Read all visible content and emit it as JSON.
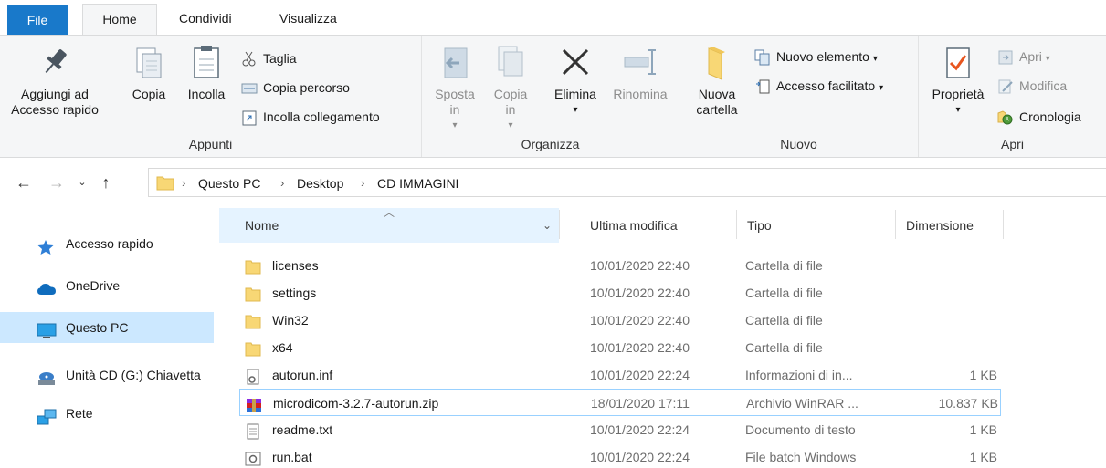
{
  "tabs": {
    "file": "File",
    "home": "Home",
    "share": "Condividi",
    "view": "Visualizza"
  },
  "ribbon": {
    "clipboard": {
      "label": "Appunti",
      "pin": "Aggiungi ad Accesso rapido",
      "copy": "Copia",
      "paste": "Incolla",
      "cut": "Taglia",
      "copy_path": "Copia percorso",
      "paste_shortcut": "Incolla collegamento"
    },
    "organize": {
      "label": "Organizza",
      "move_to": "Sposta in",
      "copy_to": "Copia in",
      "delete": "Elimina",
      "rename": "Rinomina"
    },
    "new": {
      "label": "Nuovo",
      "new_folder": "Nuova cartella",
      "new_item": "Nuovo elemento",
      "easy_access": "Accesso facilitato"
    },
    "open": {
      "label": "Apri",
      "properties": "Proprietà",
      "open": "Apri",
      "edit": "Modifica",
      "history": "Cronologia"
    }
  },
  "address": {
    "crumbs": [
      "Questo PC",
      "Desktop",
      "CD IMMAGINI"
    ]
  },
  "nav": {
    "items": [
      {
        "label": "Accesso rapido",
        "icon": "star-icon"
      },
      {
        "label": "OneDrive",
        "icon": "cloud-icon"
      },
      {
        "label": "Questo PC",
        "icon": "computer-icon",
        "selected": true
      },
      {
        "label": "Unità CD (G:) Chiavetta",
        "icon": "cd-drive-icon"
      },
      {
        "label": "Rete",
        "icon": "network-icon"
      }
    ]
  },
  "list": {
    "headers": {
      "name": "Nome",
      "date": "Ultima modifica",
      "type": "Tipo",
      "size": "Dimensione"
    },
    "rows": [
      {
        "name": "licenses",
        "date": "10/01/2020 22:40",
        "type": "Cartella di file",
        "size": "",
        "icon": "folder-icon"
      },
      {
        "name": "settings",
        "date": "10/01/2020 22:40",
        "type": "Cartella di file",
        "size": "",
        "icon": "folder-icon"
      },
      {
        "name": "Win32",
        "date": "10/01/2020 22:40",
        "type": "Cartella di file",
        "size": "",
        "icon": "folder-icon"
      },
      {
        "name": "x64",
        "date": "10/01/2020 22:40",
        "type": "Cartella di file",
        "size": "",
        "icon": "folder-icon"
      },
      {
        "name": "autorun.inf",
        "date": "10/01/2020 22:24",
        "type": "Informazioni di in...",
        "size": "1 KB",
        "icon": "settings-file-icon"
      },
      {
        "name": "microdicom-3.2.7-autorun.zip",
        "date": "18/01/2020 17:11",
        "type": "Archivio WinRAR ...",
        "size": "10.837 KB",
        "icon": "winrar-archive-icon",
        "selected": true
      },
      {
        "name": "readme.txt",
        "date": "10/01/2020 22:24",
        "type": "Documento di testo",
        "size": "1 KB",
        "icon": "text-file-icon"
      },
      {
        "name": "run.bat",
        "date": "10/01/2020 22:24",
        "type": "File batch Windows",
        "size": "1 KB",
        "icon": "batch-file-icon"
      }
    ]
  },
  "colors": {
    "accent": "#1979ca",
    "selection": "#cce8ff",
    "folder": "#f8d775"
  }
}
